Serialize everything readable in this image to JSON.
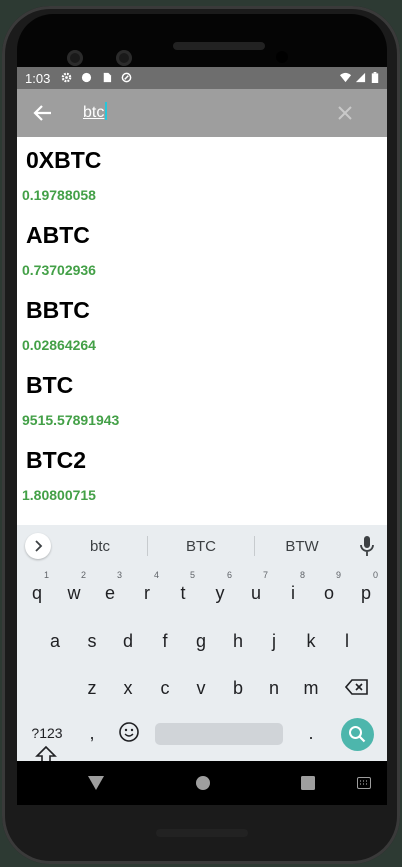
{
  "status_bar": {
    "time": "1:03"
  },
  "search": {
    "query": "btc"
  },
  "results": [
    {
      "symbol": "0XBTC",
      "price": "0.19788058"
    },
    {
      "symbol": "ABTC",
      "price": "0.73702936"
    },
    {
      "symbol": "BBTC",
      "price": "0.02864264"
    },
    {
      "symbol": "BTC",
      "price": "9515.57891943"
    },
    {
      "symbol": "BTC2",
      "price": "1.80800715"
    }
  ],
  "keyboard": {
    "suggestions": [
      "btc",
      "BTC",
      "BTW"
    ],
    "row1": [
      "q",
      "w",
      "e",
      "r",
      "t",
      "y",
      "u",
      "i",
      "o",
      "p"
    ],
    "row1_hints": [
      "1",
      "2",
      "3",
      "4",
      "5",
      "6",
      "7",
      "8",
      "9",
      "0"
    ],
    "row2": [
      "a",
      "s",
      "d",
      "f",
      "g",
      "h",
      "j",
      "k",
      "l"
    ],
    "row3": [
      "z",
      "x",
      "c",
      "v",
      "b",
      "n",
      "m"
    ],
    "symbols_key": "?123",
    "comma_key": ",",
    "period_key": "."
  },
  "colors": {
    "accent": "#4db6ac",
    "price": "#43a047",
    "appbar": "#9e9e9e",
    "statusbar": "#6e6e6e"
  }
}
